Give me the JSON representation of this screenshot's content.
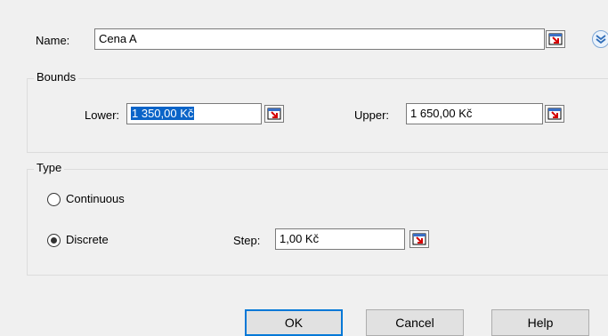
{
  "name": {
    "label": "Name:",
    "value": "Cena A"
  },
  "bounds": {
    "title": "Bounds",
    "lower_label": "Lower:",
    "lower_value": "1 350,00 Kč",
    "upper_label": "Upper:",
    "upper_value": "1 650,00 Kč"
  },
  "type": {
    "title": "Type",
    "continuous_label": "Continuous",
    "discrete_label": "Discrete",
    "selected": "Discrete",
    "step_label": "Step:",
    "step_value": "1,00 Kč"
  },
  "buttons": {
    "ok": "OK",
    "cancel": "Cancel",
    "help": "Help"
  },
  "icons": {
    "cell_reference": "cell-reference-icon",
    "expand": "expand-chevron-icon"
  },
  "colors": {
    "selection": "#0a64c8",
    "default_button_border": "#0078d7",
    "accent_red": "#d40000"
  }
}
